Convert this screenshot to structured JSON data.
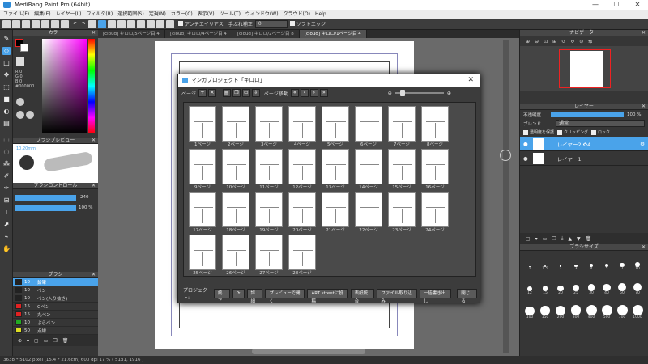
{
  "window": {
    "title": "MediBang Paint Pro (64bit)",
    "controls": [
      "—",
      "☐",
      "✕"
    ]
  },
  "menu": [
    "ファイル(F)",
    "編集(E)",
    "レイヤー(L)",
    "フィルタ(R)",
    "選択範囲(S)",
    "定規(N)",
    "カラー(C)",
    "表示(V)",
    "ツール(T)",
    "ウィンドウ(W)",
    "クラウド(O)",
    "Help"
  ],
  "toolbar": {
    "antialias_label": "アンチエイリアス",
    "stabilizer_label": "手ぶれ補正",
    "stabilizer_value": "0",
    "soft_edge_label": "ソフトエッジ"
  },
  "tabs": [
    "[cloud] キロロ/5ページ目 4",
    "[cloud] キロロ/4ページ目 4",
    "[cloud] キロロ/2ページ目 8",
    "[cloud] キロロ/1ページ目 4"
  ],
  "color_panel": {
    "title": "カラー",
    "values": [
      "R 0",
      "G 0",
      "B 0"
    ],
    "hex": "#000000"
  },
  "brush_preview": {
    "title": "ブラシプレビュー",
    "size": "10.20mm"
  },
  "brush_control": {
    "title": "ブラシコントロール",
    "size_value": "240",
    "opacity_value": "100 %"
  },
  "brush_list": {
    "title": "ブラシ",
    "items": [
      {
        "size": "10",
        "name": "鉛筆",
        "color": "#222222"
      },
      {
        "size": "10",
        "name": "ペン",
        "color": "#222222"
      },
      {
        "size": "10",
        "name": "ペン(入り抜き)",
        "color": "#222222"
      },
      {
        "size": "15",
        "name": "Gペン",
        "color": "#e22222"
      },
      {
        "size": "15",
        "name": "丸ペン",
        "color": "#e22222"
      },
      {
        "size": "10",
        "name": "ぶらペン",
        "color": "#22aa22"
      },
      {
        "size": "50",
        "name": "点線",
        "color": "#dddd22"
      }
    ]
  },
  "navigator": {
    "title": "ナビゲーター"
  },
  "layer_panel": {
    "title": "レイヤー",
    "opacity_label": "不透明度",
    "opacity_value": "100 %",
    "blend_label": "ブレンド",
    "blend_value": "通常",
    "protect_alpha": "透明度を保護",
    "clipping": "クリッピング",
    "lock": "ロック",
    "layers": [
      {
        "name": "レイヤー2 ✿4",
        "selected": true
      },
      {
        "name": "レイヤー1",
        "selected": false
      }
    ]
  },
  "brush_size": {
    "title": "ブラシサイズ",
    "sizes": [
      "1",
      "1.5",
      "2",
      "3",
      "4",
      "5",
      "7",
      "10",
      "12",
      "15",
      "20",
      "25",
      "30",
      "40",
      "50",
      "70",
      "100",
      "150",
      "200",
      "300",
      "400",
      "500",
      "700",
      "1000"
    ]
  },
  "dialog": {
    "title": "マンガプロジェクト「キロロ」",
    "page_label": "ページ",
    "move_label": "ページ移動",
    "pages": [
      "1ページ",
      "2ページ",
      "3ページ",
      "4ページ",
      "5ページ",
      "6ページ",
      "7ページ",
      "8ページ",
      "9ページ",
      "10ページ",
      "11ページ",
      "12ページ",
      "13ページ",
      "14ページ",
      "15ページ",
      "16ページ",
      "17ページ",
      "18ページ",
      "19ページ",
      "20ページ",
      "21ページ",
      "22ページ",
      "23ページ",
      "24ページ",
      "25ページ",
      "26ページ",
      "27ページ",
      "28ページ"
    ],
    "footer_label": "プロジェクト:",
    "buttons": [
      "終了",
      "⟳",
      "詳細",
      "プレビューで開く",
      "ART streetに投稿",
      "表紙統合",
      "ファイル取り込み",
      "一括書き出し"
    ],
    "close_label": "閉じる"
  },
  "status": {
    "text": "3638 * 5102 pixel (15.4 * 21.6cm) 600 dpi 17 % ( 5131, 1916 )"
  },
  "colors": {
    "accent": "#4aa3ea",
    "panel": "#363636",
    "canvas": "#6a6a6a"
  }
}
